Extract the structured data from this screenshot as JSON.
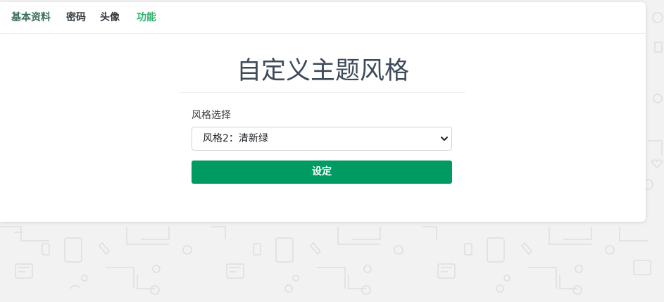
{
  "tabs": [
    {
      "label": "基本资料"
    },
    {
      "label": "密码"
    },
    {
      "label": "头像"
    },
    {
      "label": "功能"
    }
  ],
  "page": {
    "title": "自定义主题风格"
  },
  "form": {
    "theme_label": "风格选择",
    "theme_selected": "风格2：清新绿",
    "submit_label": "设定"
  },
  "colors": {
    "accent": "#009a63",
    "active_tab": "#2fb36c",
    "background": "#f2f2f2"
  }
}
